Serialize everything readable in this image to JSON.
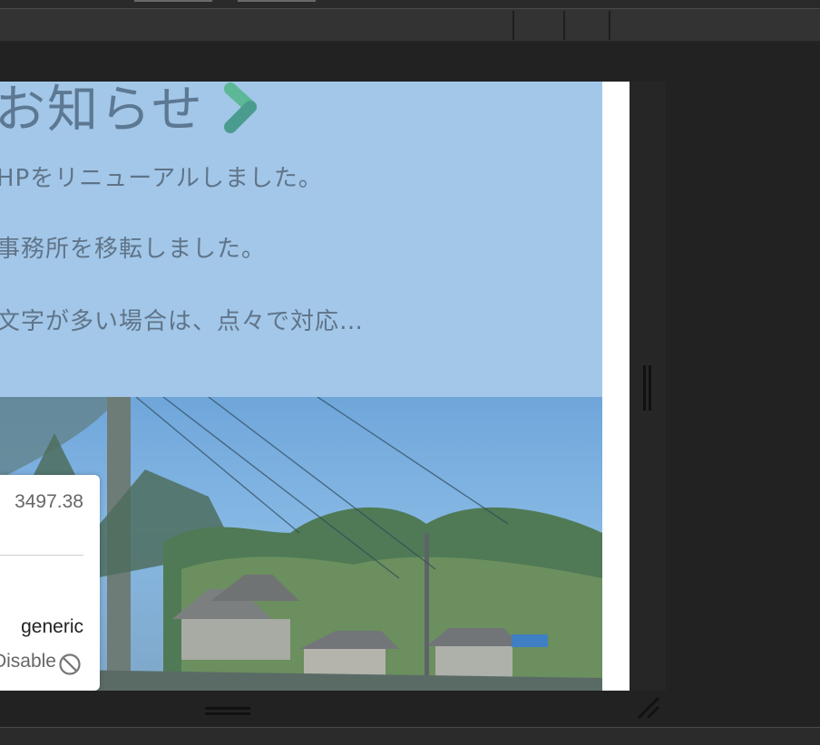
{
  "news": {
    "title": "お知らせ",
    "items": [
      "HPをリニューアルしました。",
      "事務所を移転しました。",
      "文字が多い場合は、点々で対応…"
    ]
  },
  "panel": {
    "value": "3497.38",
    "generic_label": "generic",
    "disable_label": "Disable"
  },
  "icons": {
    "chevron": "chevron-right-icon",
    "disable": "no-entry-icon",
    "resize": "resize-corner-icon"
  },
  "colors": {
    "news_bg": "#a3c7e8",
    "chevron_green": "#5cb896",
    "chevron_teal": "#4a9c8f"
  }
}
